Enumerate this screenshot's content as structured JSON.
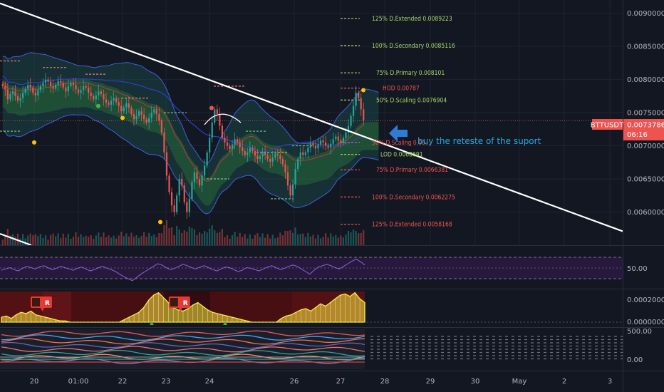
{
  "symbol": "BTTUSDT",
  "last_price": "0.0073786",
  "countdown": "06:16",
  "colors": {
    "background": "#131722",
    "bull": "#26a69a",
    "bear": "#ef5350",
    "trendline": "#ffffff",
    "band": "#2962ff",
    "annotation": "#2aa8e0",
    "rsi": "#7e57c2",
    "oscillator": "#ffeb3b"
  },
  "annotation_text": "buy the reteste of the suport",
  "chart_data": [
    {
      "type": "candlestick",
      "panel": "price",
      "x_tick_labels": [
        "20",
        "01:00",
        "22",
        "23",
        "24",
        "26",
        "27",
        "28",
        "29",
        "30",
        "May",
        "2",
        "3"
      ],
      "y_tick_labels": [
        "0.0090000",
        "0.0085000",
        "0.0080000",
        "0.0075000",
        "0.0070000",
        "0.0065000",
        "0.0060000"
      ],
      "ylim": [
        0.0055,
        0.0092
      ],
      "close_series": [
        0.0079,
        0.00785,
        0.0077,
        0.00778,
        0.00782,
        0.00775,
        0.00768,
        0.00772,
        0.0078,
        0.00786,
        0.00792,
        0.00788,
        0.0078,
        0.00776,
        0.00784,
        0.0079,
        0.00795,
        0.008,
        0.00797,
        0.0079,
        0.00786,
        0.00792,
        0.00798,
        0.00795,
        0.00788,
        0.00782,
        0.0079,
        0.00795,
        0.00792,
        0.00785,
        0.0078,
        0.00784,
        0.0079,
        0.00788,
        0.0078,
        0.00775,
        0.0077,
        0.00776,
        0.00782,
        0.00778,
        0.0077,
        0.00765,
        0.00762,
        0.00768,
        0.00772,
        0.00766,
        0.0076,
        0.00752,
        0.00758,
        0.00764,
        0.00757,
        0.00748,
        0.0074,
        0.00745,
        0.00752,
        0.00747,
        0.0074,
        0.00735,
        0.00742,
        0.0075,
        0.00755,
        0.00748,
        0.00738,
        0.0072,
        0.0069,
        0.00655,
        0.0063,
        0.0061,
        0.006,
        0.00625,
        0.0065,
        0.0064,
        0.00615,
        0.006,
        0.0062,
        0.00645,
        0.0066,
        0.0065,
        0.0064,
        0.00655,
        0.0067,
        0.0069,
        0.00712,
        0.00735,
        0.00755,
        0.00748,
        0.0073,
        0.00712,
        0.00705,
        0.007,
        0.00695,
        0.00702,
        0.0071,
        0.00705,
        0.00698,
        0.00692,
        0.00686,
        0.0069,
        0.00697,
        0.00692,
        0.00685,
        0.0068,
        0.00684,
        0.0069,
        0.00686,
        0.0068,
        0.00676,
        0.00682,
        0.00688,
        0.00686,
        0.0068,
        0.00672,
        0.0066,
        0.0064,
        0.00625,
        0.00642,
        0.00665,
        0.0068,
        0.0069,
        0.00686,
        0.0069,
        0.00697,
        0.00704,
        0.007,
        0.00696,
        0.00702,
        0.00708,
        0.00705,
        0.007,
        0.00697,
        0.00703,
        0.0071,
        0.00714,
        0.00708,
        0.00704,
        0.00712,
        0.0072,
        0.0073,
        0.00745,
        0.0076,
        0.0078,
        0.00772,
        0.00755,
        0.00738
      ],
      "levels": [
        {
          "label": "125% D.Extended 0.0089223",
          "value": 0.0089223,
          "color": "#a5d66a"
        },
        {
          "label": "100% D.Secondary 0.0085116",
          "value": 0.0085116,
          "color": "#a5d66a"
        },
        {
          "label": "75% D.Primary 0.008101",
          "value": 0.008101,
          "color": "#a5d66a"
        },
        {
          "label": "HOD 0.00787",
          "value": 0.00787,
          "color": "#ef5350"
        },
        {
          "label": "50% D.Scaling 0.0076904",
          "value": 0.0076904,
          "color": "#a5d66a"
        },
        {
          "label": "50% D.Scaling 0.00...",
          "value": 0.00705,
          "color": "#ef5350"
        },
        {
          "label": "LOD 0.0068691",
          "value": 0.0068691,
          "color": "#a5d66a"
        },
        {
          "label": "75% D.Primary 0.0066381",
          "value": 0.0066381,
          "color": "#ef5350"
        },
        {
          "label": "100% D.Secondary 0.0062275",
          "value": 0.0062275,
          "color": "#ef5350"
        },
        {
          "label": "125% D.Extended 0.0058168",
          "value": 0.0058168,
          "color": "#ef5350"
        }
      ],
      "trendline": {
        "start": [
          0,
          0.00915
        ],
        "end": [
          1,
          0.00571
        ]
      }
    },
    {
      "type": "line",
      "panel": "rsi",
      "y_tick_labels": [
        "50.00"
      ],
      "ylim": [
        20,
        80
      ],
      "values": [
        46,
        48,
        50,
        47,
        45,
        49,
        52,
        50,
        48,
        51,
        53,
        50,
        47,
        49,
        52,
        50,
        48,
        46,
        49,
        51,
        48,
        45,
        47,
        50,
        52,
        49,
        47,
        44,
        40,
        36,
        33,
        30,
        35,
        40,
        44,
        48,
        52,
        56,
        54,
        50,
        47,
        49,
        52,
        55,
        53,
        50,
        48,
        51,
        53,
        50,
        47,
        45,
        48,
        51,
        50,
        47,
        44,
        46,
        50,
        49,
        47,
        45,
        48,
        51,
        53,
        50,
        47,
        49,
        52,
        54,
        52,
        48,
        44,
        40,
        46,
        51,
        53,
        55,
        53,
        50,
        48,
        52,
        56,
        60,
        63,
        59,
        54
      ]
    },
    {
      "type": "area",
      "panel": "oscillator",
      "y_tick_labels": [
        "0.0002000",
        "0.0000000"
      ],
      "ylim": [
        0,
        0.00025
      ],
      "values": [
        4e-05,
        5e-05,
        3e-05,
        6e-05,
        8e-05,
        7e-05,
        9e-05,
        6e-05,
        5e-05,
        4e-05,
        3e-05,
        2e-05,
        1e-05,
        1e-05,
        0.0,
        0.0,
        0.0,
        0.0,
        0.0,
        0.0,
        0.0,
        0.0,
        0.0,
        0.0,
        0.0,
        2e-05,
        4e-05,
        6e-05,
        8e-05,
        0.00012,
        0.00018,
        0.00022,
        0.00024,
        0.0002,
        0.00016,
        0.00012,
        0.0001,
        9e-05,
        0.00011,
        0.00014,
        0.00016,
        0.00013,
        0.0001,
        8e-05,
        7e-05,
        6e-05,
        5e-05,
        4e-05,
        3e-05,
        2e-05,
        1e-05,
        0.0,
        0.0,
        0.0,
        0.0,
        0.0,
        0.0,
        3e-05,
        5e-05,
        6e-05,
        8e-05,
        0.0001,
        0.00011,
        9e-05,
        0.00012,
        0.00015,
        0.00013,
        0.00016,
        0.00019,
        0.00022,
        0.00023,
        0.00021,
        0.00024,
        0.00019,
        0.00016
      ],
      "markers": [
        {
          "label": "R",
          "x": 0.1
        },
        {
          "label": "R",
          "x": 0.48
        }
      ]
    },
    {
      "type": "line",
      "panel": "stack",
      "y_tick_labels": [
        "500.00",
        "0.00"
      ],
      "ylim": [
        -100,
        600
      ]
    }
  ]
}
